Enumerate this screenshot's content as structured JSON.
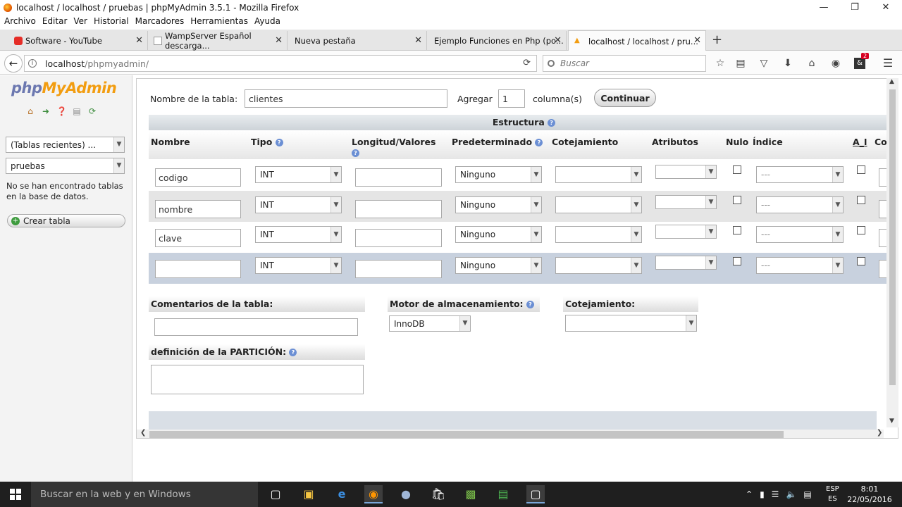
{
  "window": {
    "title": "localhost / localhost / pruebas | phpMyAdmin 3.5.1 - Mozilla Firefox"
  },
  "menu": [
    "Archivo",
    "Editar",
    "Ver",
    "Historial",
    "Marcadores",
    "Herramientas",
    "Ayuda"
  ],
  "tabs": [
    {
      "label": "Software - YouTube",
      "icon": "youtube-icon"
    },
    {
      "label": "WampServer Español descarga...",
      "icon": "page-icon"
    },
    {
      "label": "Nueva pestaña",
      "icon": ""
    },
    {
      "label": "Ejemplo Funciones en Php (po...",
      "icon": "page-icon"
    },
    {
      "label": "localhost / localhost / pru...",
      "icon": "pma-icon",
      "active": true
    }
  ],
  "nav": {
    "url_host": "localhost",
    "url_path": "/phpmyadmin/",
    "search_placeholder": "Buscar",
    "notification_count": "2"
  },
  "sidebar": {
    "logo_php": "php",
    "logo_myadmin": "MyAdmin",
    "recent_tables": "(Tablas recientes) ...",
    "database": "pruebas",
    "message": "No se han encontrado tablas en la base de datos.",
    "create_table": "Crear tabla"
  },
  "form": {
    "table_name_label": "Nombre de la tabla:",
    "table_name_value": "clientes",
    "add_label": "Agregar",
    "add_value": "1",
    "columns_label": "columna(s)",
    "continue_button": "Continuar"
  },
  "structure": {
    "title": "Estructura",
    "headers": {
      "nombre": "Nombre",
      "tipo": "Tipo",
      "longitud": "Longitud/Valores",
      "predeterminado": "Predeterminado",
      "cotejamiento": "Cotejamiento",
      "atributos": "Atributos",
      "nulo": "Nulo",
      "indice": "Índice",
      "ai": "A_I",
      "co": "Co"
    },
    "rows": [
      {
        "name": "codigo",
        "type": "INT",
        "default": "Ninguno",
        "index": "---"
      },
      {
        "name": "nombre",
        "type": "INT",
        "default": "Ninguno",
        "index": "---"
      },
      {
        "name": "clave",
        "type": "INT",
        "default": "Ninguno",
        "index": "---"
      },
      {
        "name": "",
        "type": "INT",
        "default": "Ninguno",
        "index": "---"
      }
    ]
  },
  "options": {
    "comments_label": "Comentarios de la tabla:",
    "engine_label": "Motor de almacenamiento:",
    "engine_value": "InnoDB",
    "collation_label": "Cotejamiento:",
    "partition_label": "definición de la PARTICIÓN:"
  },
  "taskbar": {
    "search": "Buscar en la web y en Windows",
    "lang_top": "ESP",
    "lang_bottom": "ES",
    "time": "8:01",
    "date": "22/05/2016"
  }
}
